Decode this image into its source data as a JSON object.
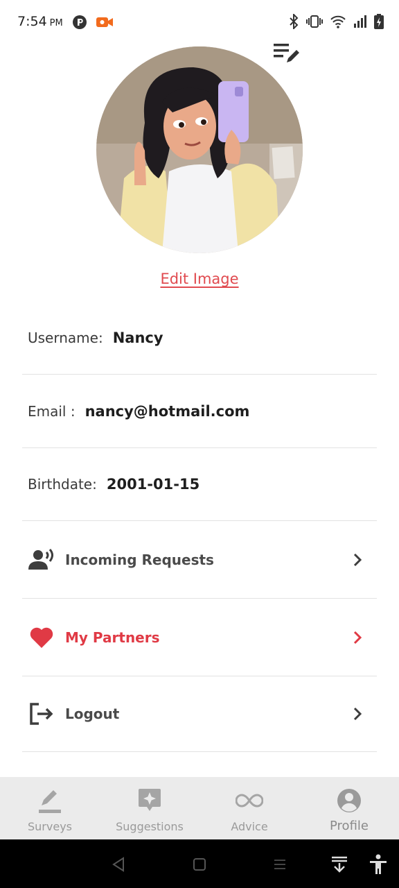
{
  "status_bar": {
    "time": "7:54",
    "ampm": "PM",
    "icons_left": [
      "p-badge-icon",
      "video-camera-icon"
    ],
    "icons_right": [
      "bluetooth-icon",
      "vibrate-icon",
      "wifi-icon",
      "signal-icon",
      "battery-charging-icon"
    ]
  },
  "header": {
    "edit_icon": "edit-list-icon"
  },
  "profile": {
    "edit_image_label": "Edit Image",
    "fields": [
      {
        "label": "Username:",
        "value": "Nancy"
      },
      {
        "label": "Email :",
        "value": "nancy@hotmail.com"
      },
      {
        "label": "Birthdate:",
        "value": "2001-01-15"
      }
    ]
  },
  "menu": [
    {
      "label": "Incoming Requests",
      "icon": "person-speaking-icon",
      "accent": false
    },
    {
      "label": "My Partners",
      "icon": "heart-icon",
      "accent": true
    },
    {
      "label": "Logout",
      "icon": "logout-icon",
      "accent": false
    }
  ],
  "tabs": [
    {
      "label": "Surveys",
      "icon": "pencil-icon"
    },
    {
      "label": "Suggestions",
      "icon": "sparkle-bubble-icon"
    },
    {
      "label": "Advice",
      "icon": "infinity-icon"
    },
    {
      "label": "Profile",
      "icon": "user-circle-icon",
      "active": true
    }
  ],
  "colors": {
    "accent": "#e03a45",
    "link": "#e04a4f",
    "tab_bar_bg": "#ebebeb",
    "nav_bar_bg": "#000000"
  }
}
